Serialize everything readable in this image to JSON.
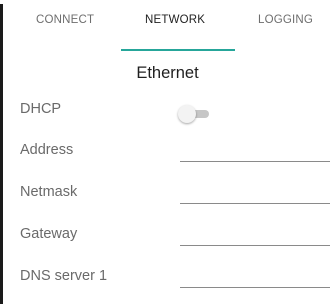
{
  "tabs": [
    {
      "label": "CONNECT",
      "active": false
    },
    {
      "label": "NETWORK",
      "active": true
    },
    {
      "label": "LOGGING",
      "active": false
    }
  ],
  "accent_color": "#26a69a",
  "section": {
    "title": "Ethernet"
  },
  "dhcp": {
    "label": "DHCP",
    "enabled": false
  },
  "fields": {
    "address": {
      "label": "Address",
      "value": ""
    },
    "netmask": {
      "label": "Netmask",
      "value": ""
    },
    "gateway": {
      "label": "Gateway",
      "value": ""
    },
    "dns1": {
      "label": "DNS server 1",
      "value": ""
    }
  }
}
